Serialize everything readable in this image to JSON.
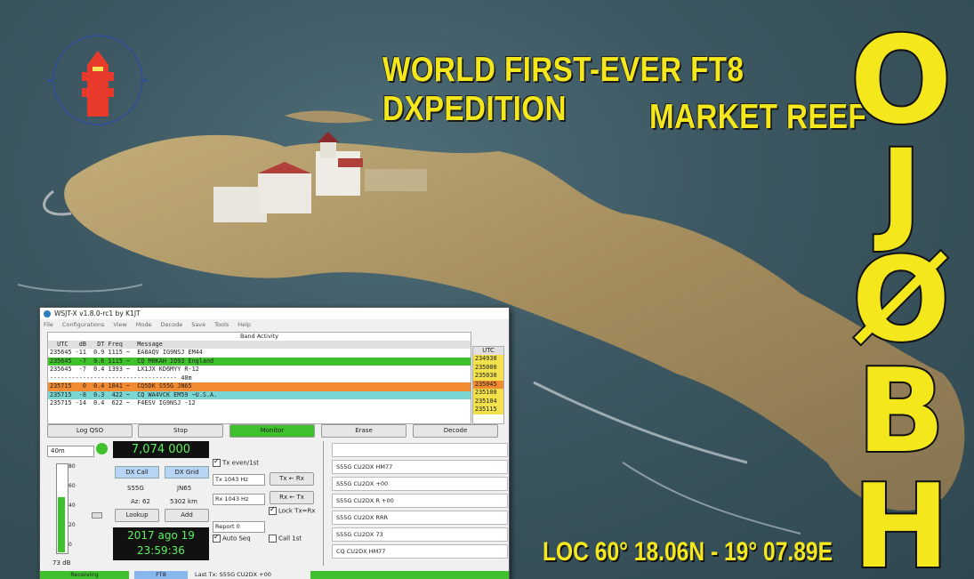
{
  "headline": {
    "line1": "WORLD FIRST-EVER FT8 DXPEDITION",
    "line2": "MARKET REEF"
  },
  "callsign": [
    "O",
    "J",
    "Ø",
    "B",
    "H"
  ],
  "location": "LOC 60° 18.06N - 19° 07.89E",
  "logo": {
    "text": "Suomen Majakkaseura Finnish Lighthouse Society",
    "icon": "lighthouse-icon"
  },
  "wsjt": {
    "title": "WSJT-X   v1.8.0-rc1   by K1JT",
    "menu": [
      "File",
      "Configurations",
      "View",
      "Mode",
      "Decode",
      "Save",
      "Tools",
      "Help"
    ],
    "band_activity_title": "Band Activity",
    "header": "  UTC   dB   DT Freq    Message",
    "rows": [
      {
        "text": "235645 -11  0.9 1115 ~  EA8AQV IG9NSJ EM44",
        "color": "#ffffff"
      },
      {
        "text": "235645  -7  0.6 1115 ~  CQ M0KAH IO93 England",
        "color": "#3ec12d"
      },
      {
        "text": "235645  -7  0.4 1393 ~  LX1JX KD6MYY R-12",
        "color": "#ffffff"
      },
      {
        "text": "----------------------------------- 40m",
        "color": "#ffffff"
      },
      {
        "text": "235715   0  0.4 1041 ~  CQ5DK S55G JN65",
        "color": "#f28a32"
      },
      {
        "text": "235715  -8  0.3  422 ~  CQ WA4VCK EM59 ~U.S.A.",
        "color": "#7ad6d2"
      },
      {
        "text": "235715 -14  0.4  622 ~  F4ESV IG9NSJ -12",
        "color": "#ffffff"
      }
    ],
    "utc_header": "UTC",
    "utc_values": [
      "234930",
      "235000",
      "235030",
      "235045",
      "235100",
      "235104",
      "235115"
    ],
    "utc_colors": [
      "#f2e14a",
      "#f2e14a",
      "#f2e14a",
      "#f28a32",
      "#f2e14a",
      "#f2e14a",
      "#f2e14a"
    ],
    "buttons": [
      "Log QSO",
      "Stop",
      "Monitor",
      "Erase",
      "Decode"
    ],
    "band": "40m",
    "frequency": "7,074 000",
    "dx_call_label": "DX Call",
    "dx_grid_label": "DX Grid",
    "dx_call": "S55G",
    "dx_grid": "JN65",
    "azimuth": "Az: 62",
    "distance": "5302 km",
    "lookup": "Lookup",
    "add": "Add",
    "meter_scale": [
      "80",
      "60",
      "40",
      "20",
      "0"
    ],
    "meter_db": "73 dB",
    "clock_date": "2017 ago 19",
    "clock_time": "23:59:36",
    "tx_even": "Tx even/1st",
    "tx_freq": "Tx  1043 Hz",
    "rx_freq": "Rx  1043 Hz",
    "tx_to_rx": "Tx ← Rx",
    "rx_to_tx": "Rx ← Tx",
    "lock": "Lock Tx=Rx",
    "report": "Report 0",
    "auto_seq": "Auto Seq",
    "call_1st": "Call 1st",
    "tx_messages": [
      "",
      "S55G CU2DX HM77",
      "S55G CU2DX +00",
      "S55G CU2DX R +00",
      "S55G CU2DX RRR",
      "S55G CU2DX 73",
      "CQ CU2DX HM77"
    ],
    "status": [
      "Receiving",
      "FT8",
      "Last Tx: S55G CU2DX +00"
    ]
  },
  "colors": {
    "headline": "#f4e81c",
    "sea": "#3d5862",
    "reef": "#b39a66"
  }
}
